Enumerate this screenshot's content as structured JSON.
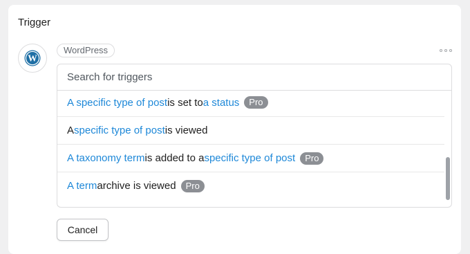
{
  "section": {
    "title": "Trigger"
  },
  "integration": {
    "name": "WordPress",
    "icon": "wordpress-logo-icon"
  },
  "menu": {
    "icon": "more-options-icon"
  },
  "search": {
    "placeholder": "Search for triggers",
    "value": ""
  },
  "triggers": [
    {
      "parts": [
        {
          "text": "A specific type of post",
          "link": true
        },
        {
          "text": " is set to ",
          "link": false
        },
        {
          "text": "a status",
          "link": true
        }
      ],
      "badge": "Pro"
    },
    {
      "parts": [
        {
          "text": "A ",
          "link": false
        },
        {
          "text": "specific type of post",
          "link": true
        },
        {
          "text": " is viewed",
          "link": false
        }
      ],
      "badge": ""
    },
    {
      "parts": [
        {
          "text": "A taxonomy term",
          "link": true
        },
        {
          "text": " is added to a ",
          "link": false
        },
        {
          "text": "specific type of post",
          "link": true
        }
      ],
      "badge": "Pro"
    },
    {
      "parts": [
        {
          "text": "A term",
          "link": true
        },
        {
          "text": " archive is viewed",
          "link": false
        }
      ],
      "badge": "Pro"
    }
  ],
  "actions": {
    "cancel_label": "Cancel"
  },
  "colors": {
    "link": "#1e88d8",
    "pro_badge": "#8c8f94",
    "wordpress_logo": "#1e6fa5",
    "background": "#f0f0f1"
  }
}
